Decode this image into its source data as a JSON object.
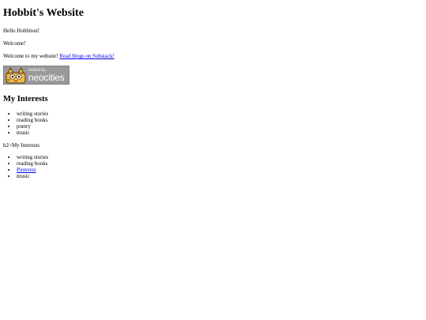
{
  "header": {
    "title": "Hobbit's Website"
  },
  "intro": {
    "hello": "Hello Hobbiton!",
    "welcome": "Welcome!",
    "welcome_text": "Welcome to my website!",
    "substack_link": "Read blogs on Substack!"
  },
  "badge": {
    "icon": "neocities-cat-icon",
    "small_text": "hosted by",
    "big_text": "neocities"
  },
  "interests": {
    "heading": "My Interests",
    "items": [
      "writing stories",
      "reading books",
      "poetry",
      "music"
    ]
  },
  "raw_heading": "h2>My Interests",
  "interests2": {
    "items": [
      "writing stories",
      "reading books",
      "Pinterest",
      "music"
    ]
  }
}
